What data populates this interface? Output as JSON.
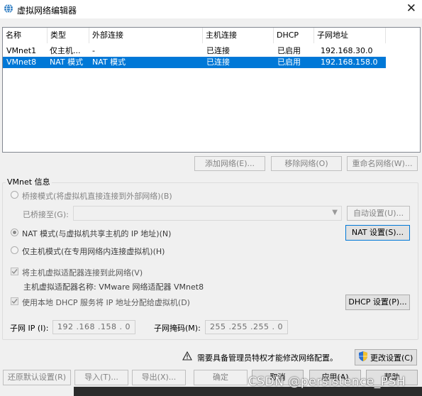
{
  "window": {
    "title": "虚拟网络编辑器",
    "close_glyph": "✕"
  },
  "network_list": {
    "columns": [
      "名称",
      "类型",
      "外部连接",
      "主机连接",
      "DHCP",
      "子网地址"
    ],
    "rows": [
      {
        "name": "VMnet1",
        "type": "仅主机...",
        "external": "-",
        "host": "已连接",
        "dhcp": "已启用",
        "subnet": "192.168.30.0",
        "selected": false
      },
      {
        "name": "VMnet8",
        "type": "NAT 模式",
        "external": "NAT 模式",
        "host": "已连接",
        "dhcp": "已启用",
        "subnet": "192.168.158.0",
        "selected": true
      }
    ]
  },
  "list_buttons": {
    "add": "添加网络(E)...",
    "remove": "移除网络(O)",
    "rename": "重命名网络(W)..."
  },
  "vmnet_info": {
    "group_title": "VMnet 信息",
    "bridge_radio": "桥接模式(将虚拟机直接连接到外部网络)(B)",
    "bridged_to_label": "已桥接至(G):",
    "bridged_to_value": "",
    "auto_settings": "自动设置(U)...",
    "nat_radio": "NAT 模式(与虚拟机共享主机的 IP 地址)(N)",
    "nat_settings": "NAT 设置(S)...",
    "host_only_radio": "仅主机模式(在专用网络内连接虚拟机)(H)",
    "connect_adapter_check": "将主机虚拟适配器连接到此网络(V)",
    "adapter_name_label": "主机虚拟适配器名称: VMware 网络适配器 VMnet8",
    "dhcp_check": "使用本地 DHCP 服务将 IP 地址分配给虚拟机(D)",
    "dhcp_settings": "DHCP 设置(P)...",
    "subnet_ip_label": "子网 IP (I):",
    "subnet_ip_value": "192 .168 .158 .  0",
    "subnet_mask_label": "子网掩码(M):",
    "subnet_mask_value": "255 .255 .255 .  0"
  },
  "admin_notice": {
    "text": "需要具备管理员特权才能修改网络配置。",
    "change_settings": "更改设置(C)"
  },
  "footer_buttons": {
    "restore_defaults": "还原默认设置(R)",
    "import": "导入(T)...",
    "export": "导出(X)...",
    "ok": "确定",
    "cancel": "取消",
    "apply": "应用(A)",
    "help": "帮助"
  },
  "watermark": "CSDN @persistence_PSH",
  "colors": {
    "selection": "#0078d7",
    "window_bg": "#f0f0f0",
    "accent": "#0078d7"
  }
}
